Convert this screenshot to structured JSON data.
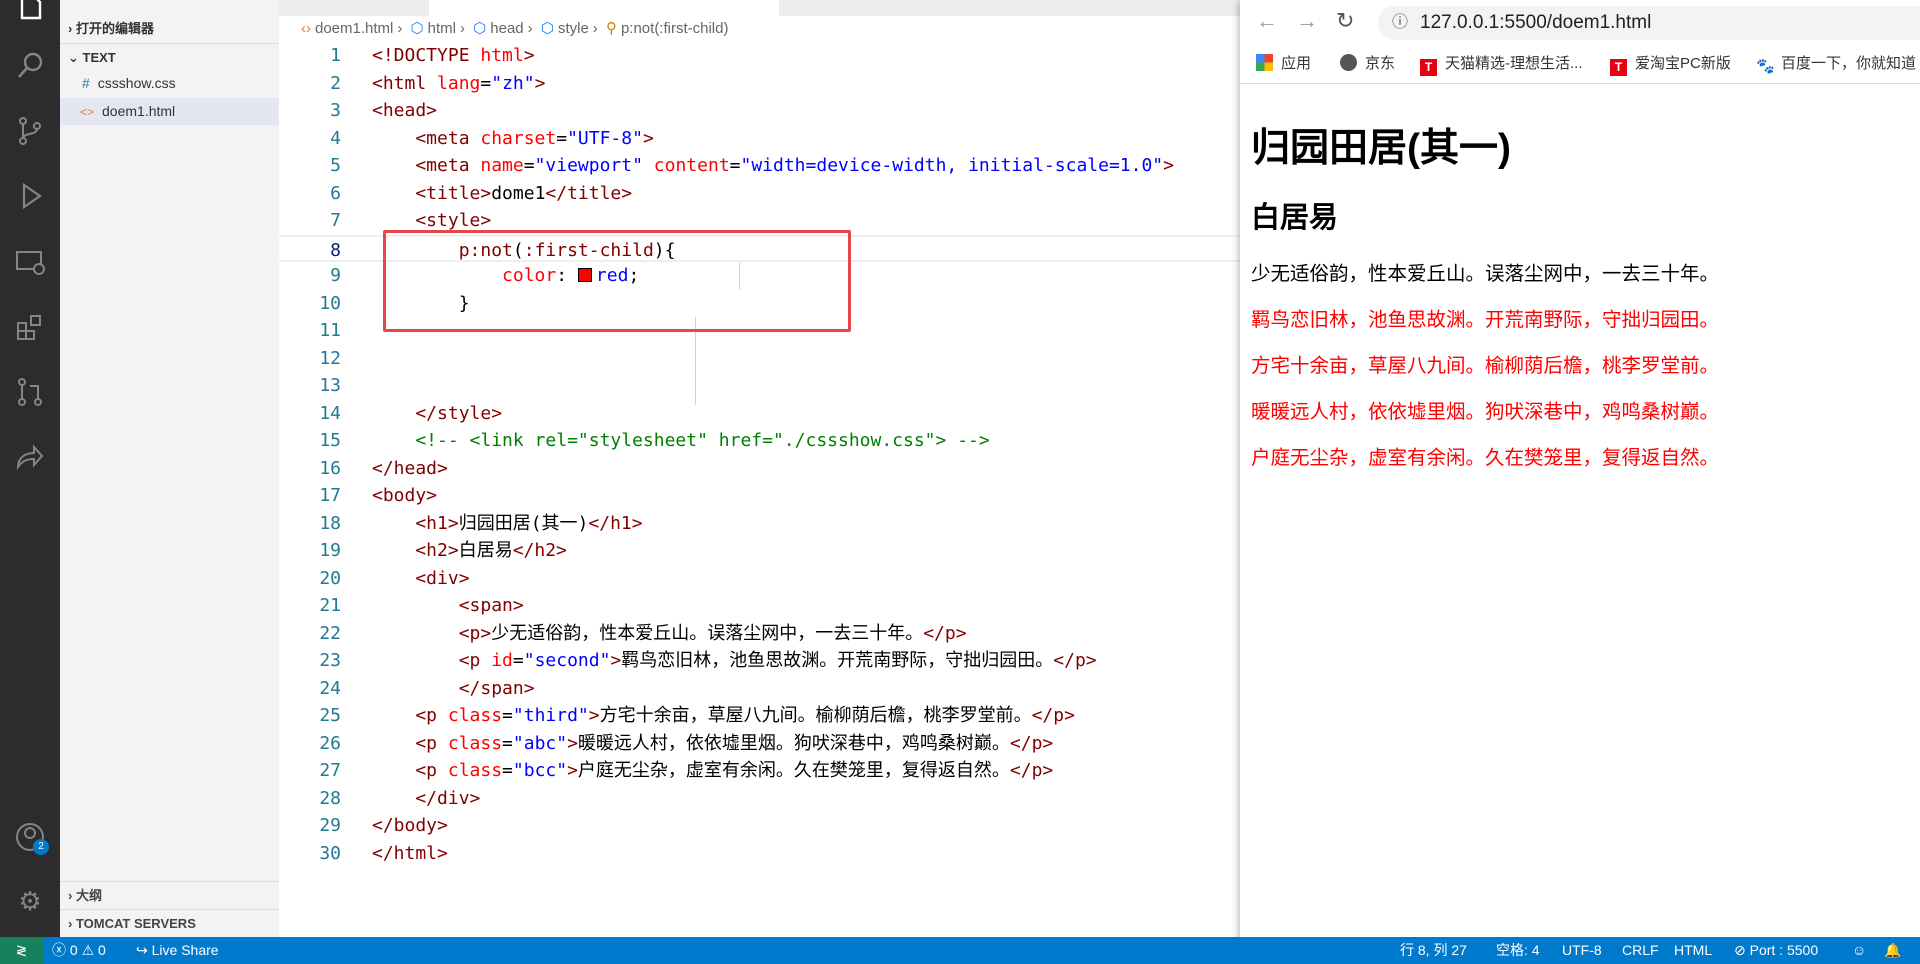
{
  "activity_bar": {
    "icons": [
      "explorer-icon",
      "search-icon",
      "source-control-icon",
      "run-debug-icon",
      "remote-explorer-icon",
      "extensions-icon",
      "pull-requests-icon",
      "live-share-icon",
      "account-icon",
      "gear-icon"
    ],
    "account_badge": "2"
  },
  "sidebar": {
    "open_editors": "打开的编辑器",
    "folder": "TEXT",
    "files": [
      {
        "name": "cssshow.css",
        "icon": "#"
      },
      {
        "name": "doem1.html",
        "icon": "<>",
        "selected": true
      }
    ],
    "outline": "大纲",
    "tomcat": "TOMCAT SERVERS"
  },
  "editor": {
    "breadcrumb": [
      "doem1.html",
      "html",
      "head",
      "style",
      "p:not(:first-child)"
    ],
    "current_line": 8,
    "lines": [
      [
        [
          "<!DOCTYPE ",
          "t"
        ],
        [
          "html",
          "a"
        ],
        [
          ">",
          "t"
        ]
      ],
      [
        [
          "<html ",
          "t"
        ],
        [
          "lang",
          "a"
        ],
        [
          "=",
          "x"
        ],
        [
          "\"zh\"",
          "v"
        ],
        [
          ">",
          "t"
        ]
      ],
      [
        [
          "<head>",
          "t"
        ]
      ],
      [
        [
          "    <meta ",
          "t"
        ],
        [
          "charset",
          "a"
        ],
        [
          "=",
          "x"
        ],
        [
          "\"UTF-8\"",
          "v"
        ],
        [
          ">",
          "t"
        ]
      ],
      [
        [
          "    <meta ",
          "t"
        ],
        [
          "name",
          "a"
        ],
        [
          "=",
          "x"
        ],
        [
          "\"viewport\"",
          "v"
        ],
        [
          " ",
          "x"
        ],
        [
          "content",
          "a"
        ],
        [
          "=",
          "x"
        ],
        [
          "\"width=device-width, initial-scale=1.0\"",
          "v"
        ],
        [
          ">",
          "t"
        ]
      ],
      [
        [
          "    <title>",
          "t"
        ],
        [
          "dome1",
          "x"
        ],
        [
          "</title>",
          "t"
        ]
      ],
      [
        [
          "    <style>",
          "t"
        ]
      ],
      [
        [
          "        p:not",
          "s"
        ],
        [
          "(",
          "x"
        ],
        [
          ":first-child",
          "s"
        ],
        [
          "){",
          "x"
        ]
      ],
      [
        [
          "            ",
          "x"
        ],
        [
          "color",
          "p"
        ],
        [
          ": ",
          "x"
        ],
        [
          "",
          "sw"
        ],
        [
          "red",
          "v"
        ],
        [
          ";",
          "x"
        ]
      ],
      [
        [
          "        }",
          "x"
        ]
      ],
      [],
      [],
      [],
      [
        [
          "    </style>",
          "t"
        ]
      ],
      [
        [
          "    <!-- <link rel=\"stylesheet\" href=\"./cssshow.css\"> -->",
          "c"
        ]
      ],
      [
        [
          "</head>",
          "t"
        ]
      ],
      [
        [
          "<body>",
          "t"
        ]
      ],
      [
        [
          "    <h1>",
          "t"
        ],
        [
          "归园田居(其一)",
          "x"
        ],
        [
          "</h1>",
          "t"
        ]
      ],
      [
        [
          "    <h2>",
          "t"
        ],
        [
          "白居易",
          "x"
        ],
        [
          "</h2>",
          "t"
        ]
      ],
      [
        [
          "    <div>",
          "t"
        ]
      ],
      [
        [
          "        <span>",
          "t"
        ]
      ],
      [
        [
          "        <p>",
          "t"
        ],
        [
          "少无适俗韵，性本爱丘山。误落尘网中，一去三十年。",
          "x"
        ],
        [
          "</p>",
          "t"
        ]
      ],
      [
        [
          "        <p ",
          "t"
        ],
        [
          "id",
          "a"
        ],
        [
          "=",
          "x"
        ],
        [
          "\"second\"",
          "v"
        ],
        [
          ">",
          "t"
        ],
        [
          "羁鸟恋旧林，池鱼思故渊。开荒南野际，守拙归园田。",
          "x"
        ],
        [
          "</p>",
          "t"
        ]
      ],
      [
        [
          "        </span>",
          "t"
        ]
      ],
      [
        [
          "    <p ",
          "t"
        ],
        [
          "class",
          "a"
        ],
        [
          "=",
          "x"
        ],
        [
          "\"third\"",
          "v"
        ],
        [
          ">",
          "t"
        ],
        [
          "方宅十余亩，草屋八九间。榆柳荫后檐，桃李罗堂前。",
          "x"
        ],
        [
          "</p>",
          "t"
        ]
      ],
      [
        [
          "    <p ",
          "t"
        ],
        [
          "class",
          "a"
        ],
        [
          "=",
          "x"
        ],
        [
          "\"abc\"",
          "v"
        ],
        [
          ">",
          "t"
        ],
        [
          "暖暖远人村，依依墟里烟。狗吠深巷中，鸡鸣桑树巅。",
          "x"
        ],
        [
          "</p>",
          "t"
        ]
      ],
      [
        [
          "    <p ",
          "t"
        ],
        [
          "class",
          "a"
        ],
        [
          "=",
          "x"
        ],
        [
          "\"bcc\"",
          "v"
        ],
        [
          ">",
          "t"
        ],
        [
          "户庭无尘杂，虚室有余闲。久在樊笼里，复得返自然。",
          "x"
        ],
        [
          "</p>",
          "t"
        ]
      ],
      [
        [
          "    </div>",
          "t"
        ]
      ],
      [
        [
          "</body>",
          "t"
        ]
      ],
      [
        [
          "</html>",
          "t"
        ]
      ]
    ]
  },
  "browser": {
    "url": "127.0.0.1:5500/doem1.html",
    "bookmarks": [
      {
        "label": "应用",
        "icon": "apps-icon"
      },
      {
        "label": "京东",
        "icon": "globe-icon"
      },
      {
        "label": "天猫精选-理想生活...",
        "icon": "tmall-icon"
      },
      {
        "label": "爱淘宝PC新版",
        "icon": "tmall-icon"
      },
      {
        "label": "百度一下，你就知道",
        "icon": "baidu-icon"
      }
    ],
    "page": {
      "h1": "归园田居(其一)",
      "h2": "白居易",
      "paragraphs": [
        {
          "text": "少无适俗韵，性本爱丘山。误落尘网中，一去三十年。",
          "color": "#000000"
        },
        {
          "text": "羁鸟恋旧林，池鱼思故渊。开荒南野际，守拙归园田。",
          "color": "#ff0000"
        },
        {
          "text": "方宅十余亩，草屋八九间。榆柳荫后檐，桃李罗堂前。",
          "color": "#ff0000"
        },
        {
          "text": "暖暖远人村，依依墟里烟。狗吠深巷中，鸡鸣桑树巅。",
          "color": "#ff0000"
        },
        {
          "text": "户庭无尘杂，虚室有余闲。久在樊笼里，复得返自然。",
          "color": "#ff0000"
        }
      ]
    }
  },
  "status": {
    "errors": "0",
    "warnings": "0",
    "live_share": "Live Share",
    "position": "行 8, 列 27",
    "spaces": "空格: 4",
    "encoding": "UTF-8",
    "eol": "CRLF",
    "language": "HTML",
    "port": "Port : 5500"
  },
  "colors": {
    "status_bar": "#007acc",
    "remote": "#16825d",
    "highlight_box": "#e6474d"
  }
}
